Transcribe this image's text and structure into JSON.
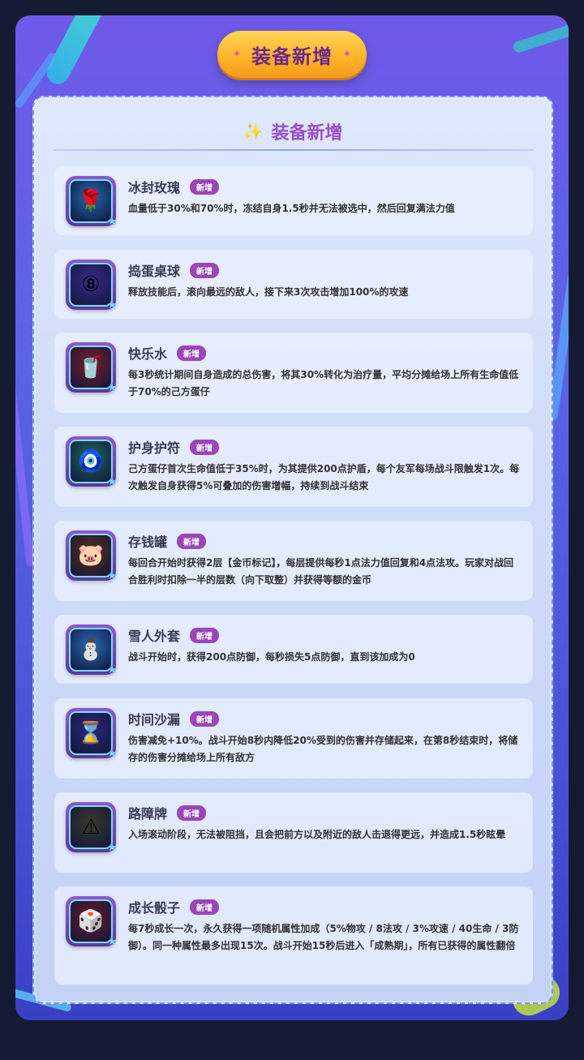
{
  "header": {
    "title": "装备新增",
    "spark": "✦"
  },
  "panel": {
    "title": "装备新增",
    "spark": "✨"
  },
  "badge_label": "新增",
  "items": [
    {
      "name": "冰封玫瑰",
      "desc": "血量低于30%和70%时，冻结自身1.5秒并无法被选中，然后回复满法力值",
      "icon": "ice-rose-icon",
      "glyph": "🌹",
      "bg": "#1e6ab0"
    },
    {
      "name": "捣蛋桌球",
      "desc": "释放技能后，滚向最远的敌人，接下来3次攻击增加100%的攻速",
      "icon": "eight-ball-icon",
      "glyph": "⑧",
      "bg": "#3a2a8a"
    },
    {
      "name": "快乐水",
      "desc": "每3秒统计期间自身造成的总伤害，将其30%转化为治疗量，平均分摊给场上所有生命值低于70%的己方蛋仔",
      "icon": "soda-icon",
      "glyph": "🥤",
      "bg": "#7a1f2a"
    },
    {
      "name": "护身护符",
      "desc": "己方蛋仔首次生命值低于35%时，为其提供200点护盾，每个友军每场战斗限触发1次。每次触发自身获得5%可叠加的伤害增幅，持续到战斗结束",
      "icon": "amulet-icon",
      "glyph": "🧿",
      "bg": "#1f6a5a"
    },
    {
      "name": "存钱罐",
      "desc": "每回合开始时获得2层【金币标记】，每层提供每秒1点法力值回复和4点法攻。玩家对战回合胜利时扣除一半的层数（向下取整）并获得等额的金币",
      "icon": "piggy-bank-icon",
      "glyph": "🐷",
      "bg": "#5a3018"
    },
    {
      "name": "雪人外套",
      "desc": "战斗开始时，获得200点防御，每秒损失5点防御，直到该加成为0",
      "icon": "snowman-icon",
      "glyph": "⛄",
      "bg": "#2a6ab8"
    },
    {
      "name": "时间沙漏",
      "desc": "伤害减免+10%。战斗开始8秒内降低20%受到的伤害并存储起来，在第8秒结束时，将储存的伤害分摊给场上所有敌方",
      "icon": "hourglass-icon",
      "glyph": "⌛",
      "bg": "#2a2a7a"
    },
    {
      "name": "路障牌",
      "desc": "入场滚动阶段，无法被阻挡，且会把前方以及附近的敌人击退得更远，并造成1.5秒眩晕",
      "icon": "roadblock-icon",
      "glyph": "⚠",
      "bg": "#3a3a2a"
    },
    {
      "name": "成长骰子",
      "desc": "每7秒成长一次，永久获得一项随机属性加成（5%物攻 / 8法攻 / 3%攻速 / 40生命 / 3防御）。同一种属性最多出现15次。战斗开始15秒后进入「成熟期」，所有已获得的属性翻倍",
      "icon": "dice-icon",
      "glyph": "🎲",
      "bg": "#6a1a2a"
    }
  ]
}
